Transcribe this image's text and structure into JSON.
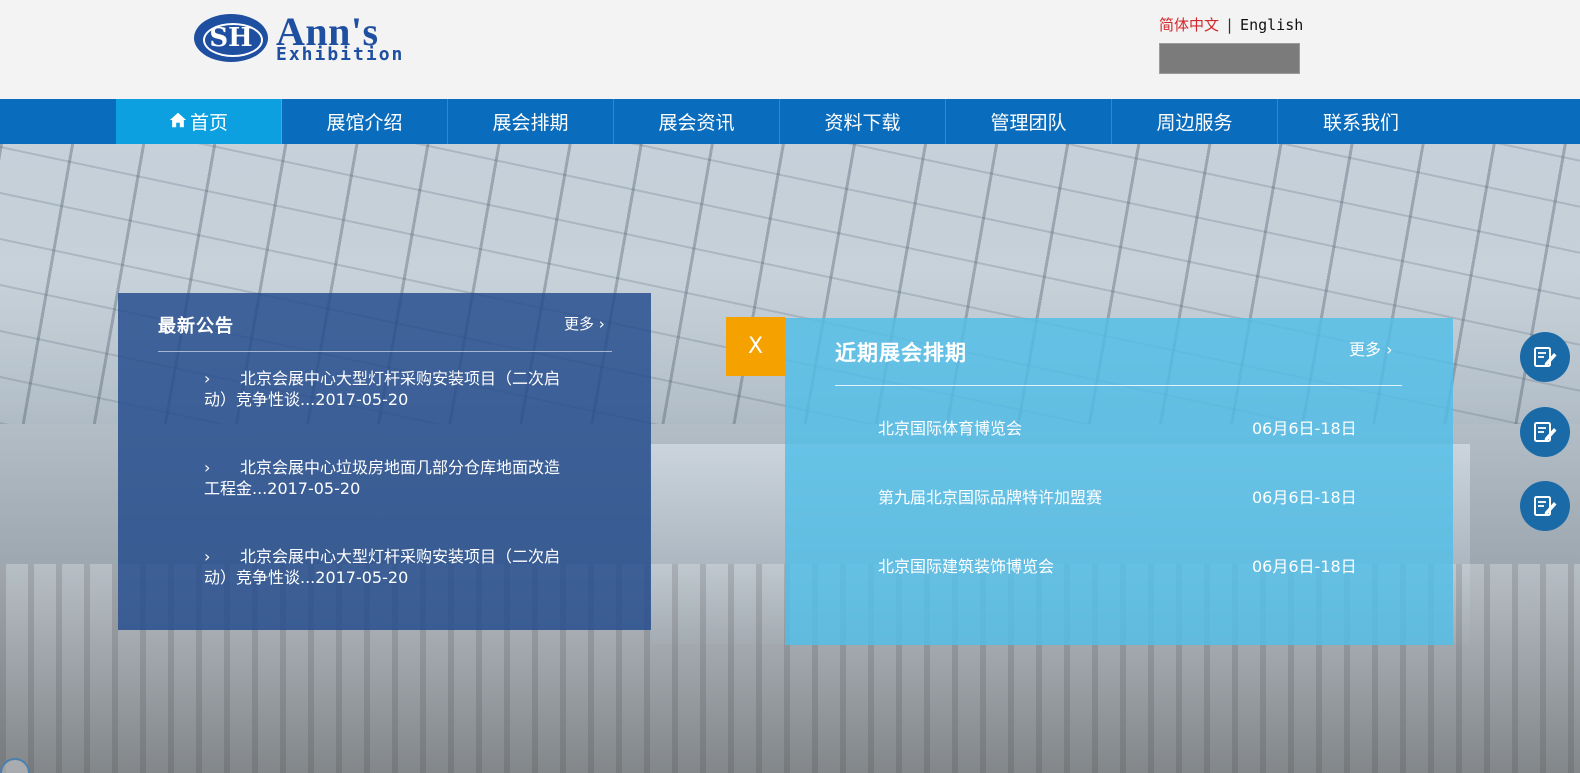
{
  "header": {
    "logo_mark": "SH",
    "logo_name": "Ann's",
    "logo_sub": "Exhibition",
    "lang_cn": "简体中文",
    "lang_sep": "|",
    "lang_en": "English"
  },
  "nav": {
    "items": [
      {
        "label": "首页",
        "active": true
      },
      {
        "label": "展馆介绍"
      },
      {
        "label": "展会排期"
      },
      {
        "label": "展会资讯"
      },
      {
        "label": "资料下载"
      },
      {
        "label": "管理团队"
      },
      {
        "label": "周边服务"
      },
      {
        "label": "联系我们"
      }
    ]
  },
  "notice": {
    "title": "最新公告",
    "more": "更多 ›",
    "items": [
      {
        "arrow": "›",
        "text": "北京会展中心大型灯杆采购安装项目（二次启动）竞争性谈...2017-05-20"
      },
      {
        "arrow": "›",
        "text": "北京会展中心垃圾房地面几部分仓库地面改造工程金...2017-05-20"
      },
      {
        "arrow": "›",
        "text": "北京会展中心大型灯杆采购安装项目（二次启动）竞争性谈...2017-05-20"
      }
    ]
  },
  "close_label": "X",
  "schedule": {
    "title": "近期展会排期",
    "more": "更多 ›",
    "rows": [
      {
        "name": "北京国际体育博览会",
        "date": "06月6日-18日"
      },
      {
        "name": "第九届北京国际品牌特许加盟赛",
        "date": "06月6日-18日"
      },
      {
        "name": "北京国际建筑装饰博览会",
        "date": "06月6日-18日"
      }
    ]
  },
  "colors": {
    "nav": "#0a6cbc",
    "nav_active": "#0ca0e0",
    "notice_bg": "#224a8c",
    "schedule_bg": "#50bee8",
    "close_bg": "#f5a100",
    "lang_active": "#d3262b"
  },
  "icons": {
    "home": "home-icon",
    "side_tools": [
      "edit-note-icon",
      "edit-note-icon",
      "edit-note-icon"
    ]
  }
}
